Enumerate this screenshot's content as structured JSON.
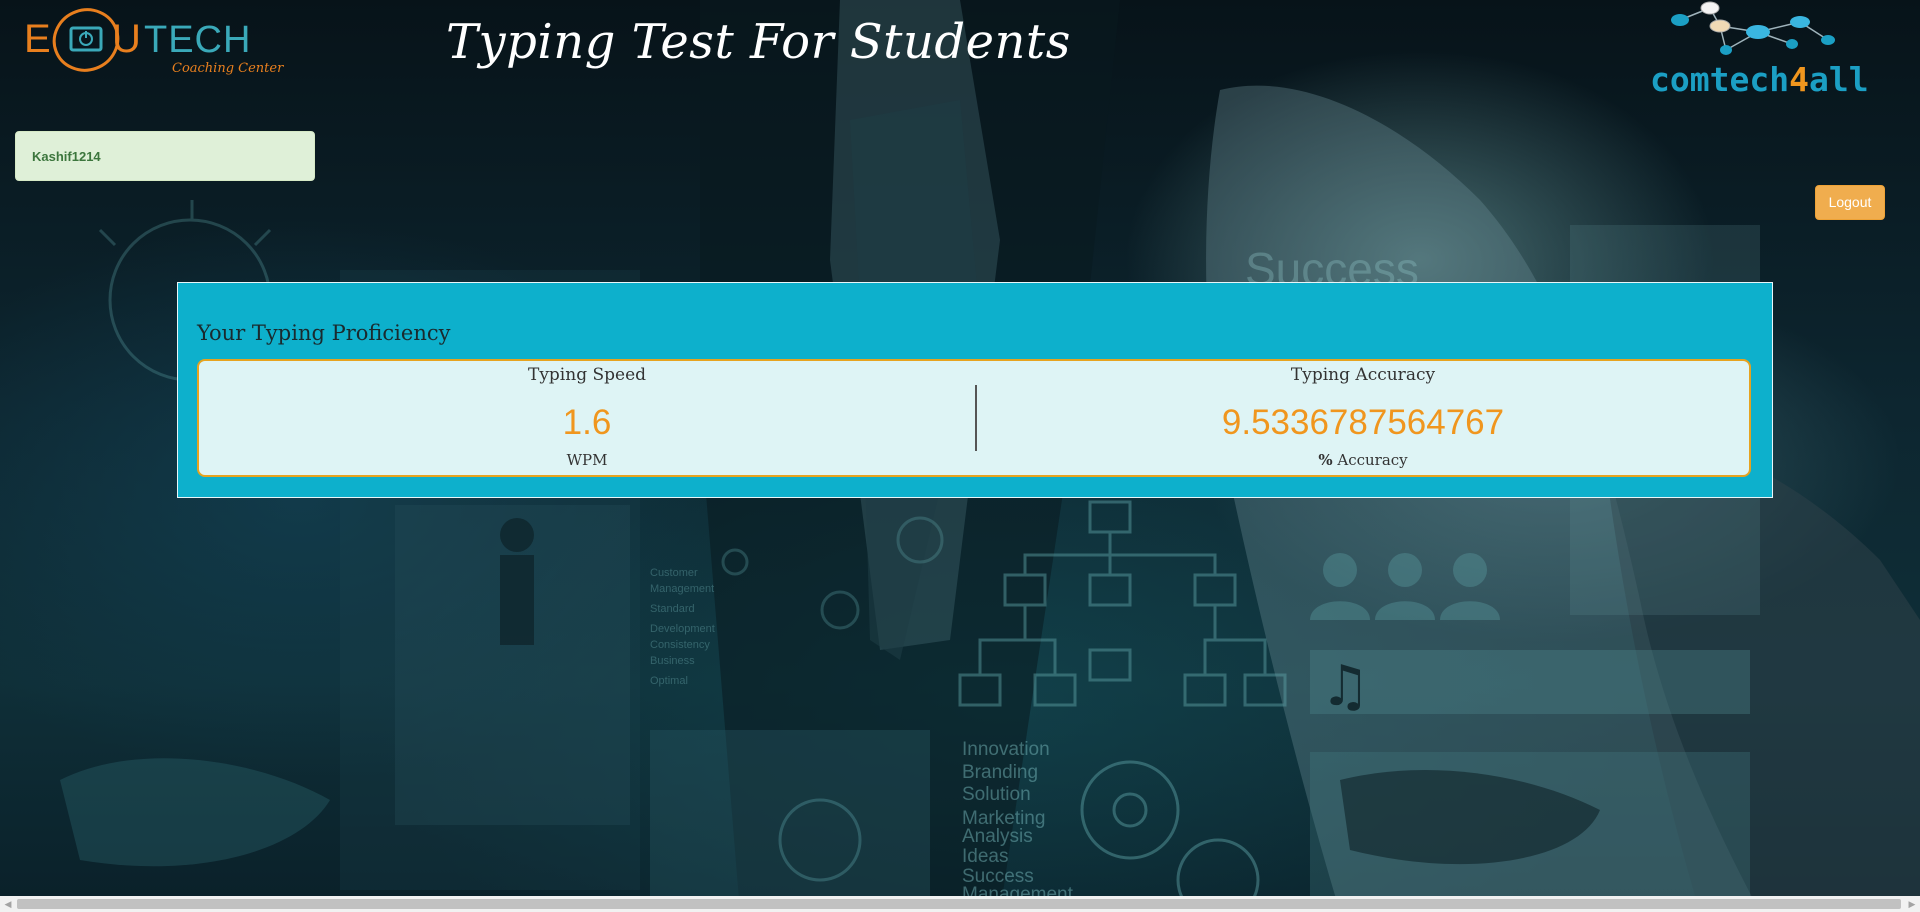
{
  "header": {
    "title": "Typing Test For Students",
    "edu_logo": {
      "text_left": "E",
      "text_mid": "U",
      "text_right": "TECH",
      "subtitle": "Coaching Center"
    },
    "comtech_logo": {
      "text": "comtech",
      "number": "4",
      "suffix": "all"
    }
  },
  "user": {
    "name": "Kashif1214"
  },
  "logout": {
    "label": "Logout"
  },
  "result": {
    "heading": "Your Typing Proficiency",
    "speed": {
      "label": "Typing Speed",
      "value": "1.6",
      "unit": "WPM"
    },
    "accuracy": {
      "label": "Typing Accuracy",
      "value": "9.5336787564767",
      "unit_symbol": "%",
      "unit": "Accuracy"
    }
  },
  "colors": {
    "panel": "#0db0cc",
    "inner": "#def4f5",
    "accent_orange": "#f0961e",
    "logout_btn": "#f0ad4e",
    "user_box": "#dff0d8",
    "comtech_blue": "#1b9fc4"
  },
  "background": {
    "overlay_words": [
      "Innovation",
      "Branding",
      "Solution",
      "Marketing",
      "Analysis",
      "Ideas",
      "Success",
      "Management"
    ],
    "small_words": [
      "Customer",
      "Management",
      "Standard",
      "Development",
      "Consistency",
      "Business",
      "Optimal"
    ],
    "banner_word": "Success"
  },
  "icons": {
    "scroll_left": "scroll-left-arrow-icon",
    "scroll_right": "scroll-right-arrow-icon"
  }
}
